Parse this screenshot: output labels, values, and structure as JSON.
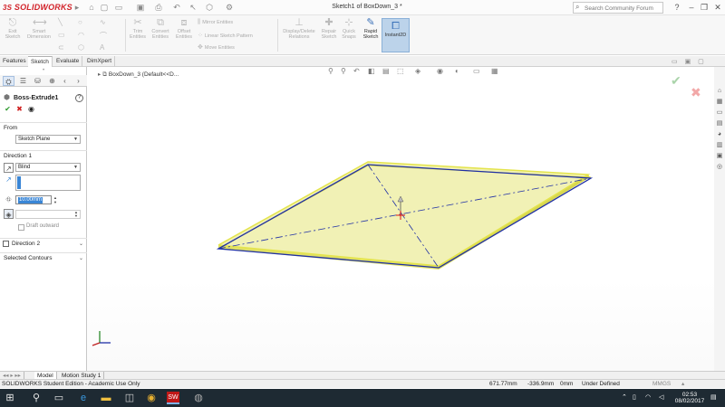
{
  "app": {
    "logo_text": "SOLIDWORKS",
    "logo_prefix": "3S",
    "document_title": "Sketch1 of BoxDown_3 *",
    "search_placeholder": "Search Community Forum"
  },
  "command_manager": {
    "tools": [
      {
        "label": "Exit\nSketch"
      },
      {
        "label": "Smart\nDimension"
      },
      {
        "label": "Trim\nEntities"
      },
      {
        "label": "Convert\nEntities"
      },
      {
        "label": "Offset\nEntities"
      },
      {
        "label": "Display/Delete\nRelations"
      },
      {
        "label": "Repair\nSketch"
      },
      {
        "label": "Quick\nSnaps"
      },
      {
        "label": "Rapid\nSketch"
      },
      {
        "label": "Instant2D"
      }
    ],
    "small_items": [
      "Mirror Entities",
      "Linear Sketch Pattern",
      "Move Entities"
    ]
  },
  "tabs": [
    "Features",
    "Sketch",
    "Evaluate",
    "DimXpert"
  ],
  "active_tab": "Sketch",
  "property_manager": {
    "feature_name": "Boss-Extrude1",
    "help": "?",
    "from_label": "From",
    "from_value": "Sketch Plane",
    "direction1_label": "Direction 1",
    "end_condition": "Blind",
    "depth_value": "10.00mm",
    "draft_outward": "Draft outward",
    "direction2_label": "Direction 2",
    "selected_contours_label": "Selected Contours"
  },
  "viewport": {
    "tree_item": "BoxDown_3  (Default<<D..."
  },
  "bottom_tabs": [
    "Model",
    "Motion Study 1"
  ],
  "status_bar": {
    "edition": "SOLIDWORKS Student Edition - Academic Use Only",
    "x": "671.77mm",
    "y": "-336.9mm",
    "z": "0mm",
    "state": "Under Defined",
    "units": "MMGS"
  },
  "taskbar": {
    "time": "02:53",
    "date": "08/02/2017"
  },
  "colors": {
    "face_fill": "#efefa8",
    "edge_yellow": "#d9d94a",
    "sketch_blue": "#1f2fa6",
    "accent": "#3a86d6"
  }
}
